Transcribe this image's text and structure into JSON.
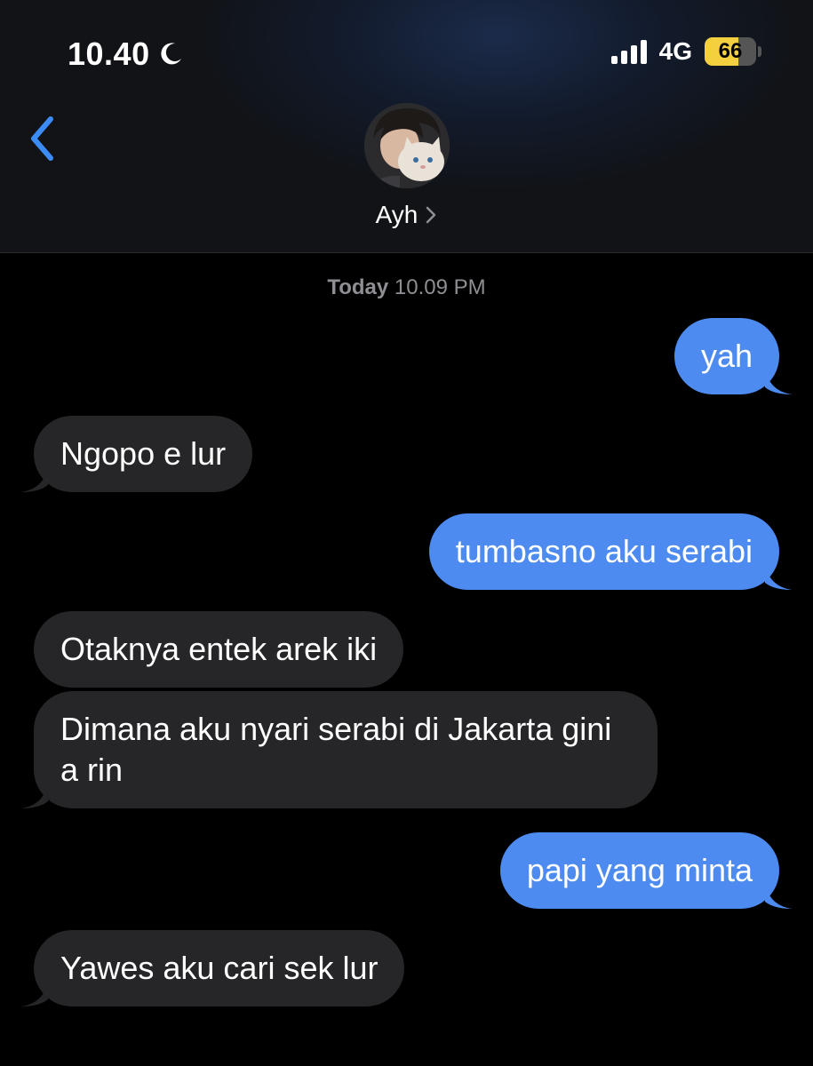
{
  "status_bar": {
    "time": "10.40",
    "network": "4G",
    "battery_level": "66",
    "battery_fraction": 0.66,
    "signal_bars": 4
  },
  "header": {
    "contact_name": "Ayh"
  },
  "timestamp": {
    "day": "Today",
    "time": "10.09 PM"
  },
  "messages": [
    {
      "direction": "sent",
      "text": "yah"
    },
    {
      "direction": "received",
      "text": "Ngopo e lur"
    },
    {
      "direction": "sent",
      "text": "tumbasno aku serabi"
    },
    {
      "direction": "received",
      "text": "Otaknya entek arek iki"
    },
    {
      "direction": "received",
      "text": "Dimana aku nyari serabi di Jakarta gini a rin"
    },
    {
      "direction": "sent",
      "text": "papi yang minta"
    },
    {
      "direction": "received",
      "text": "Yawes aku cari sek lur"
    }
  ],
  "colors": {
    "sent_bubble": "#4d8bf0",
    "received_bubble": "#262629",
    "accent": "#3b8cf6"
  },
  "icons": {
    "back": "chevron-left-icon",
    "moon": "moon-icon",
    "contact_chevron": "chevron-right-icon"
  }
}
